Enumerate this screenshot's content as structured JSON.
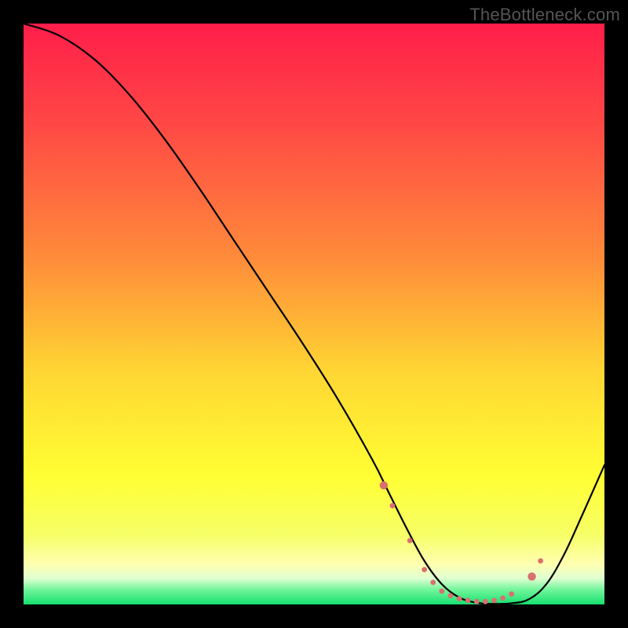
{
  "watermark": "TheBottleneck.com",
  "chart_data": {
    "type": "line",
    "title": "",
    "xlabel": "",
    "ylabel": "",
    "xlim": [
      0,
      100
    ],
    "ylim": [
      0,
      100
    ],
    "background_gradient": [
      {
        "stop": 0.0,
        "color": "#ff1e4a"
      },
      {
        "stop": 0.18,
        "color": "#ff4a45"
      },
      {
        "stop": 0.4,
        "color": "#ff8a3a"
      },
      {
        "stop": 0.6,
        "color": "#ffd633"
      },
      {
        "stop": 0.78,
        "color": "#ffff33"
      },
      {
        "stop": 0.88,
        "color": "#f6ff66"
      },
      {
        "stop": 0.93,
        "color": "#ffffb0"
      },
      {
        "stop": 0.955,
        "color": "#e0ffd0"
      },
      {
        "stop": 0.975,
        "color": "#70f59a"
      },
      {
        "stop": 1.0,
        "color": "#16e070"
      }
    ],
    "series": [
      {
        "name": "bottleneck-curve",
        "color": "#000000",
        "width": 2.2,
        "x": [
          0,
          6,
          12,
          18,
          24,
          30,
          36,
          42,
          48,
          54,
          60,
          63,
          66,
          69,
          72,
          75,
          78,
          81,
          84,
          87,
          90,
          93,
          96,
          100
        ],
        "y": [
          100,
          98,
          94,
          88,
          80.5,
          72,
          63,
          54,
          45,
          35.5,
          25,
          19,
          13,
          7.5,
          3.5,
          1.2,
          0.3,
          0.1,
          0.2,
          0.9,
          3.5,
          8.5,
          15,
          24
        ]
      }
    ],
    "markers": {
      "name": "floor-dots",
      "color": "#d97070",
      "radius_small": 3.4,
      "radius_large": 5.2,
      "points": [
        {
          "x": 62,
          "y": 20.5,
          "r": "large"
        },
        {
          "x": 63.5,
          "y": 17.0,
          "r": "small"
        },
        {
          "x": 66.5,
          "y": 11.0,
          "r": "small"
        },
        {
          "x": 69.0,
          "y": 6.0,
          "r": "small"
        },
        {
          "x": 70.5,
          "y": 3.8,
          "r": "small"
        },
        {
          "x": 72.0,
          "y": 2.3,
          "r": "small"
        },
        {
          "x": 73.5,
          "y": 1.5,
          "r": "small"
        },
        {
          "x": 75.0,
          "y": 1.0,
          "r": "small"
        },
        {
          "x": 76.5,
          "y": 0.7,
          "r": "small"
        },
        {
          "x": 78.0,
          "y": 0.5,
          "r": "small"
        },
        {
          "x": 79.5,
          "y": 0.5,
          "r": "small"
        },
        {
          "x": 81.0,
          "y": 0.7,
          "r": "small"
        },
        {
          "x": 82.5,
          "y": 1.1,
          "r": "small"
        },
        {
          "x": 84.0,
          "y": 1.8,
          "r": "small"
        },
        {
          "x": 87.5,
          "y": 4.8,
          "r": "large"
        },
        {
          "x": 89.0,
          "y": 7.5,
          "r": "small"
        }
      ]
    }
  }
}
